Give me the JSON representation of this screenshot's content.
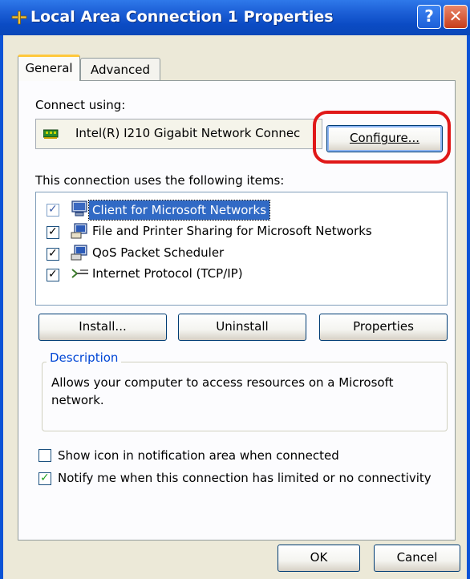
{
  "window": {
    "title": "Local Area Connection 1 Properties",
    "help_label": "?",
    "close_label": "✕"
  },
  "tabs": {
    "general": "General",
    "advanced": "Advanced"
  },
  "connect_using": {
    "label": "Connect using:",
    "adapter": "Intel(R) I210 Gigabit Network Connec",
    "configure_button": "Configure..."
  },
  "items_label": "This connection uses the following items:",
  "items": [
    {
      "label": "Client for Microsoft Networks",
      "checked": true,
      "selected": true,
      "icon": "network-client-icon"
    },
    {
      "label": "File and Printer Sharing for Microsoft Networks",
      "checked": true,
      "selected": false,
      "icon": "file-sharing-icon"
    },
    {
      "label": "QoS Packet Scheduler",
      "checked": true,
      "selected": false,
      "icon": "qos-scheduler-icon"
    },
    {
      "label": "Internet Protocol (TCP/IP)",
      "checked": true,
      "selected": false,
      "icon": "protocol-icon"
    }
  ],
  "buttons": {
    "install": "Install...",
    "uninstall": "Uninstall",
    "properties": "Properties"
  },
  "description": {
    "title": "Description",
    "text": "Allows your computer to access resources on a Microsoft network."
  },
  "options": {
    "show_icon": {
      "label": "Show icon in notification area when connected",
      "checked": false
    },
    "notify": {
      "label": "Notify me when this connection has limited or no connectivity",
      "checked": true
    }
  },
  "footer": {
    "ok": "OK",
    "cancel": "Cancel"
  },
  "colors": {
    "titlebar": "#0b4bc4",
    "selection": "#316ac5",
    "callout": "#e01818",
    "dialog_bg": "#ece9d8"
  }
}
